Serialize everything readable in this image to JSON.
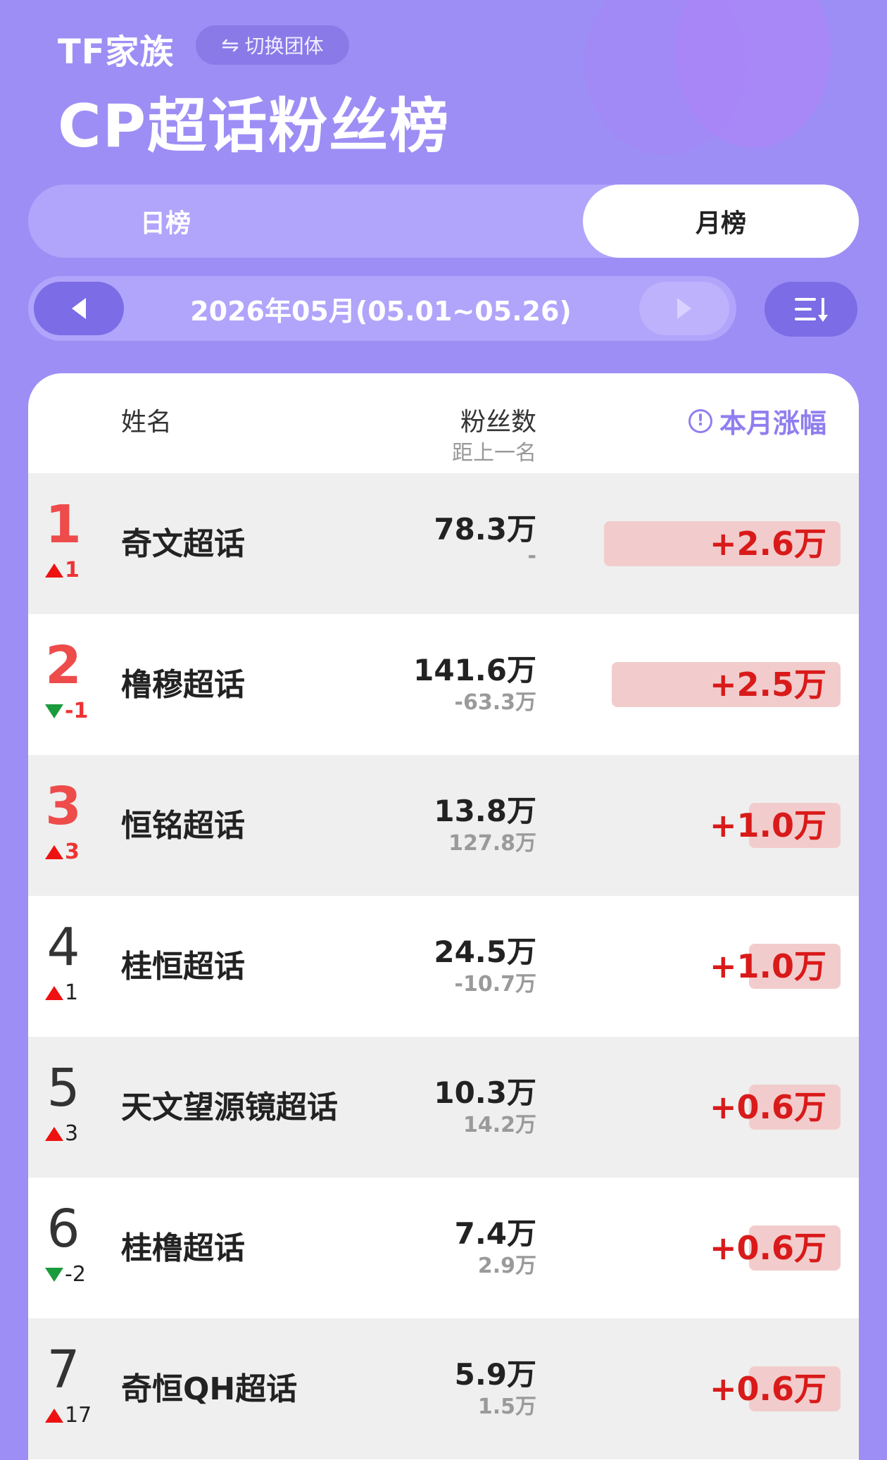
{
  "header": {
    "brand": "TF家族",
    "switch_label": "切换团体",
    "switch_icon": "⇋",
    "title": "CP超话粉丝榜"
  },
  "tabs": [
    {
      "label": "日榜",
      "active": false
    },
    {
      "label": "月榜",
      "active": true
    }
  ],
  "date_bar": {
    "label": "2026年05月(05.01~05.26)"
  },
  "table": {
    "col_name": "姓名",
    "col_fans": "粉丝数",
    "col_gap": "距上一名",
    "col_growth": "本月涨幅",
    "info_icon": "!",
    "rows": [
      {
        "rank": "1",
        "dir": "up",
        "change": "1",
        "name": "奇文超话",
        "fans": "78.3万",
        "gap": "-",
        "growth": "+2.6万",
        "growth_share": 0.6
      },
      {
        "rank": "2",
        "dir": "down",
        "change": "-1",
        "name": "橹穆超话",
        "fans": "141.6万",
        "gap": "-63.3万",
        "growth": "+2.5万",
        "growth_share": 0.58
      },
      {
        "rank": "3",
        "dir": "up",
        "change": "3",
        "name": "恒铭超话",
        "fans": "13.8万",
        "gap": "127.8万",
        "growth": "+1.0万",
        "growth_share": 0.23
      },
      {
        "rank": "4",
        "dir": "up",
        "change": "1",
        "name": "桂恒超话",
        "fans": "24.5万",
        "gap": "-10.7万",
        "growth": "+1.0万",
        "growth_share": 0.23
      },
      {
        "rank": "5",
        "dir": "up",
        "change": "3",
        "name": "天文望源镜超话",
        "fans": "10.3万",
        "gap": "14.2万",
        "growth": "+0.6万",
        "growth_share": 0.14
      },
      {
        "rank": "6",
        "dir": "down",
        "change": "-2",
        "name": "桂橹超话",
        "fans": "7.4万",
        "gap": "2.9万",
        "growth": "+0.6万",
        "growth_share": 0.14
      },
      {
        "rank": "7",
        "dir": "up",
        "change": "17",
        "name": "奇恒QH超话",
        "fans": "5.9万",
        "gap": "1.5万",
        "growth": "+0.6万",
        "growth_share": 0.14
      }
    ]
  }
}
